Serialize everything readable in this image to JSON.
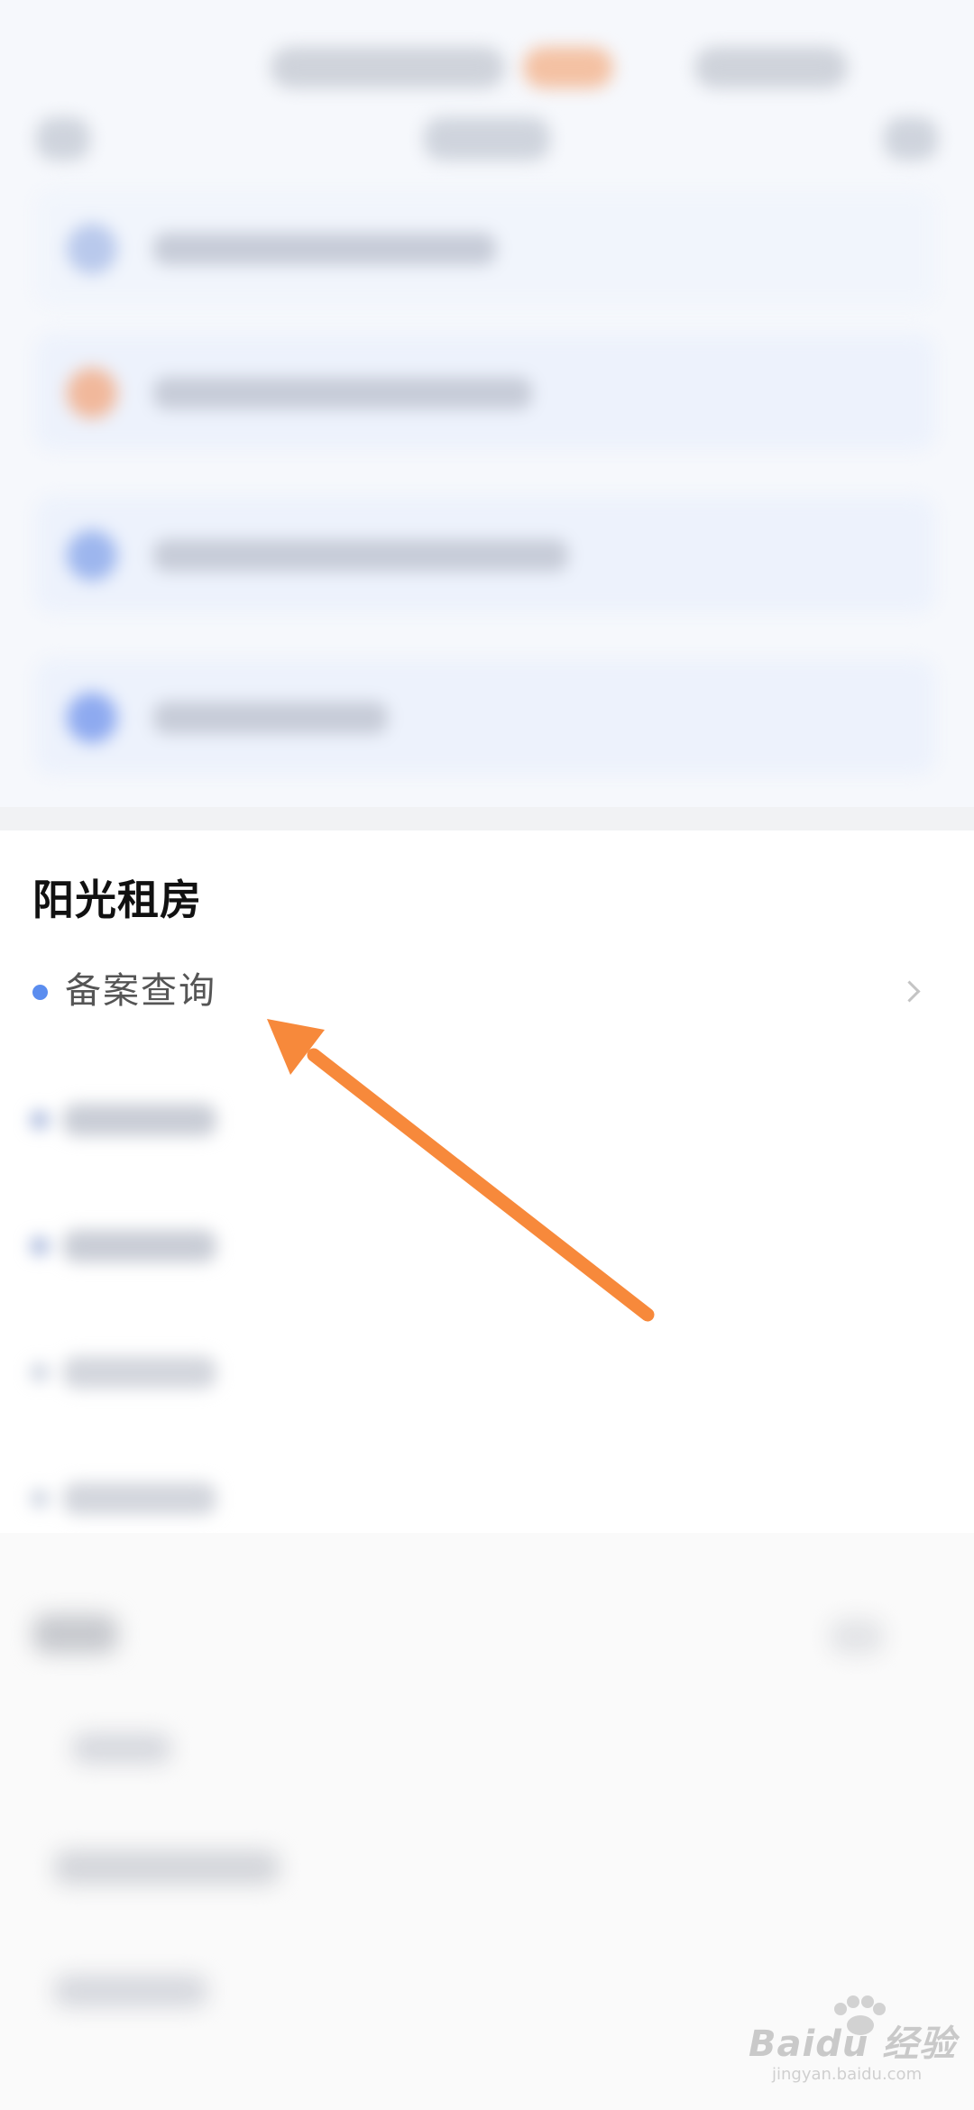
{
  "section": {
    "title": "阳光租房",
    "items": [
      {
        "label": "备案查询",
        "bullet_color": "#5b8def"
      }
    ]
  },
  "annotation": {
    "arrow_color": "#f7893b"
  },
  "watermark": {
    "text": "Baidu 经验",
    "subtext": "jingyan.baidu.com"
  }
}
